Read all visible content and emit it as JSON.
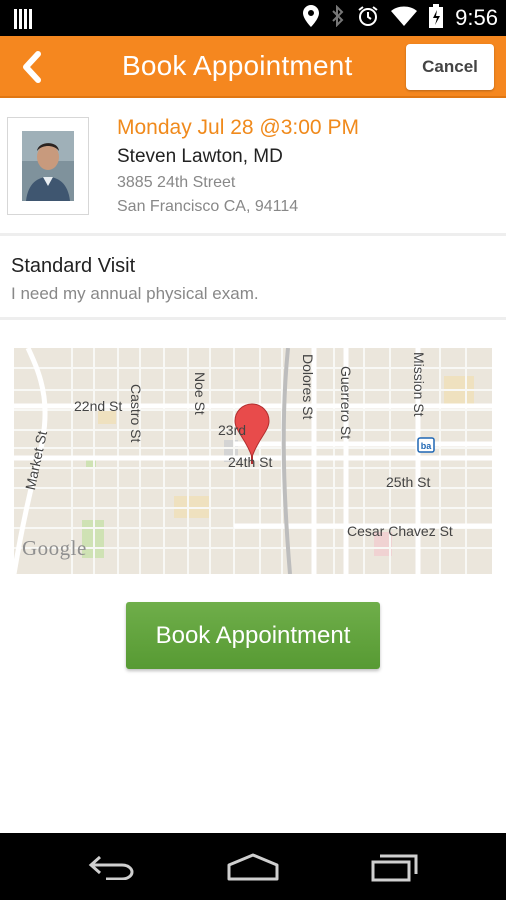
{
  "status_bar": {
    "time": "9:56",
    "icons": [
      "signal-bars-icon",
      "location-pin-icon",
      "bluetooth-icon",
      "alarm-icon",
      "wifi-icon",
      "battery-icon"
    ]
  },
  "header": {
    "title": "Book Appointment",
    "back_icon": "back-chevron-icon",
    "cancel_label": "Cancel"
  },
  "appointment": {
    "datetime": "Monday Jul 28 @3:00 PM",
    "doctor_name": "Steven Lawton, MD",
    "address_line1": "3885 24th Street",
    "address_line2": "San Francisco CA, 94114"
  },
  "visit": {
    "type": "Standard Visit",
    "reason": "I need my annual physical exam."
  },
  "map": {
    "labels": {
      "market": "Market St",
      "castro": "Castro St",
      "noe": "Noe St",
      "dolores": "Dolores St",
      "guerrero": "Guerrero St",
      "mission": "Mission St",
      "s22nd": "22nd St",
      "s23rd": "23rd",
      "s24th": "24th St",
      "s25th": "25th St",
      "cesar": "Cesar Chavez St"
    },
    "attribution": "Google",
    "transit_badge": "ba"
  },
  "actions": {
    "book_label": "Book Appointment"
  },
  "nav": {
    "back": "back-arrow-icon",
    "home": "home-icon",
    "recents": "recent-apps-icon"
  },
  "colors": {
    "accent": "#f5871f",
    "date_text": "#f08a1c",
    "book_button": "#5fa33a"
  }
}
